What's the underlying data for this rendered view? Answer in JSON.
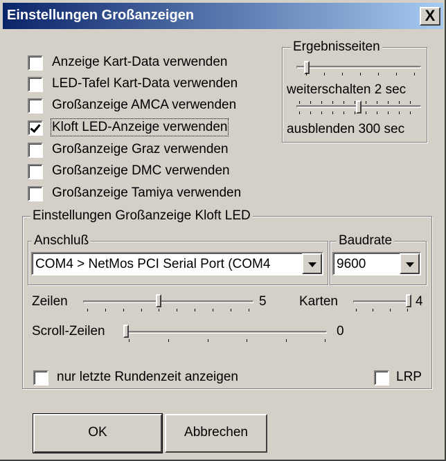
{
  "window": {
    "title": "Einstellungen Großanzeigen",
    "close_label": "X"
  },
  "checkboxes": [
    {
      "label": "Anzeige Kart-Data verwenden",
      "checked": false
    },
    {
      "label": "LED-Tafel Kart-Data verwenden",
      "checked": false
    },
    {
      "label": "Großanzeige AMCA verwenden",
      "checked": false
    },
    {
      "label": "Kloft LED-Anzeige verwenden",
      "checked": true
    },
    {
      "label": "Großanzeige Graz verwenden",
      "checked": false
    },
    {
      "label": "Großanzeige DMC verwenden",
      "checked": false
    },
    {
      "label": "Großanzeige Tamiya verwenden",
      "checked": false
    }
  ],
  "ergebnisseiten": {
    "legend": "Ergebnisseiten",
    "weiterschalten_label": "weiterschalten 2 sec",
    "ausblenden_label": "ausblenden 300 sec"
  },
  "kloft": {
    "legend": "Einstellungen Großanzeige Kloft LED",
    "anschluss_legend": "Anschluß",
    "anschluss_value": "COM4 > NetMos PCI Serial Port (COM4",
    "baudrate_legend": "Baudrate",
    "baudrate_value": "9600",
    "zeilen_label": "Zeilen",
    "zeilen_value": "5",
    "karten_label": "Karten",
    "karten_value": "4",
    "scroll_label": "Scroll-Zeilen",
    "scroll_value": "0",
    "nur_letzte_label": "nur letzte Rundenzeit anzeigen",
    "lrp_label": "LRP"
  },
  "buttons": {
    "ok": "OK",
    "cancel": "Abbrechen"
  }
}
